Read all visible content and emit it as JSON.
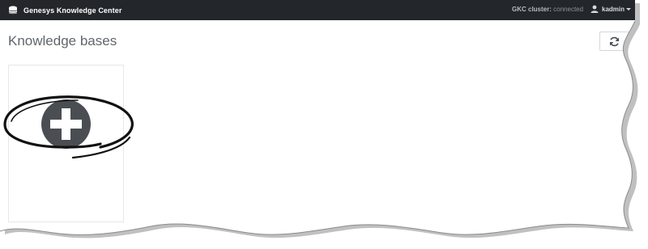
{
  "window": {
    "brand_label": "Genesys Knowledge Center",
    "brand_icon": "database-icon"
  },
  "topbar": {
    "cluster_label": "GKC cluster:",
    "cluster_status": "connected",
    "user_name": "kadmin",
    "user_icon": "user-icon",
    "user_menu_icon": "caret-down-icon"
  },
  "main": {
    "page_title": "Knowledge bases",
    "refresh_icon": "refresh-icon",
    "add_icon": "plus-circle-icon"
  },
  "colors": {
    "topbar_bg": "#23272b",
    "add_button": "#4a4e53",
    "title_text": "#5f656b"
  }
}
